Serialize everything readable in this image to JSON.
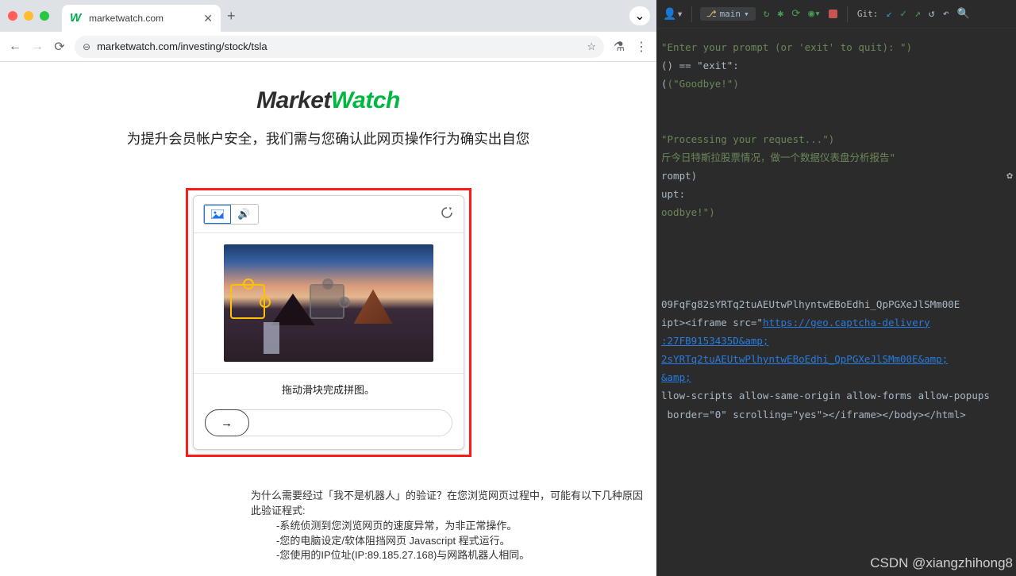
{
  "browser": {
    "tab": {
      "title": "marketwatch.com",
      "favicon": "W"
    },
    "url": "marketwatch.com/investing/stock/tsla"
  },
  "page": {
    "logo": {
      "part1": "Market",
      "part2": "Watch"
    },
    "headline": "为提升会员帐户安全，我们需与您确认此网页操作行为确实出自您",
    "captcha": {
      "instruction": "拖动滑块完成拼图。",
      "arrow": "→"
    },
    "explanation": {
      "q": "为什么需要经过「我不是机器人」的验证？在您浏览网页过程中，可能有以下几种原因",
      "a": "此验证程式:",
      "r1": "-系统侦测到您浏览网页的速度异常，为非正常操作。",
      "r2": "-您的电脑设定/软体阻挡网页 Javascript 程式运行。",
      "r3": "-您使用的IP位址(IP:89.185.27.168)与网路机器人相同。"
    }
  },
  "ide": {
    "toolbar": {
      "branch": "main",
      "git_label": "Git:"
    },
    "code": {
      "l1": "\"Enter your prompt (or 'exit' to quit): \")",
      "l2": "() == \"exit\":",
      "l3": "(\"Goodbye!\")",
      "l4": "",
      "l5": "\"Processing your request...\")",
      "l6": "斤今日特斯拉股票情况，做一个数据仪表盘分析报告\"",
      "l7": "rompt)",
      "l8": "upt:",
      "l9": "oodbye!\")",
      "l10": "",
      "l11": "",
      "l12": "",
      "l13": "09FqFg82sYRTq2tuAEUtwPlhyntwEBoEdhi_QpPGXeJlSMm00E",
      "l14a": "ipt><iframe src=\"",
      "l14b": "https://geo.captcha-delivery",
      "l15": ":27FB9153435D&amp;",
      "l16": "2sYRTq2tuAEUtwPlhyntwEBoEdhi_QpPGXeJlSMm00E&amp;",
      "l17": "&amp;",
      "l18": "llow-scripts allow-same-origin allow-forms allow-popups",
      "l19": " border=\"0\" scrolling=\"yes\"></iframe></body></html>"
    },
    "watermark": "CSDN @xiangzhihong8"
  }
}
